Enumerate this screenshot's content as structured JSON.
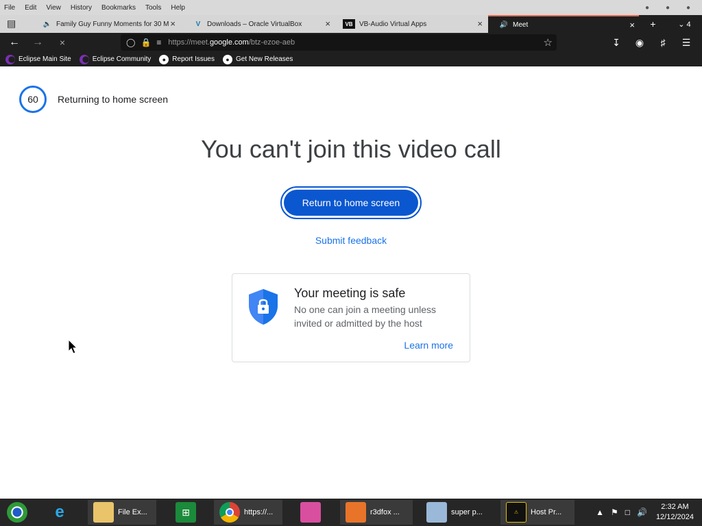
{
  "menubar": {
    "items": [
      "File",
      "Edit",
      "View",
      "History",
      "Bookmarks",
      "Tools",
      "Help"
    ]
  },
  "tabs": [
    {
      "label": "Family Guy Funny Moments for 30 M",
      "icon": "audio-tab-icon"
    },
    {
      "label": "Downloads – Oracle VirtualBox",
      "icon": "virtualbox-icon"
    },
    {
      "label": "VB-Audio Virtual Apps",
      "icon": "vb-audio-icon",
      "icon_text": "VB"
    },
    {
      "label": "Meet",
      "icon": "speaker-icon",
      "active": true
    }
  ],
  "tab_overflow_count": "4",
  "address_bar": {
    "prefix": "https://meet.",
    "domain": "google.com",
    "path": "/btz-ezoe-aeb"
  },
  "bookmarks": [
    {
      "label": "Eclipse Main Site",
      "icon": "eclipse-icon"
    },
    {
      "label": "Eclipse Community",
      "icon": "eclipse-icon"
    },
    {
      "label": "Report Issues",
      "icon": "github-icon"
    },
    {
      "label": "Get New Releases",
      "icon": "github-icon"
    }
  ],
  "meet": {
    "countdown": "60",
    "countdown_label": "Returning to home screen",
    "headline": "You can't join this video call",
    "return_button": "Return to home screen",
    "feedback_link": "Submit feedback",
    "safe_title": "Your meeting is safe",
    "safe_desc": "No one can join a meeting unless invited or admitted by the host",
    "learn_more": "Learn more"
  },
  "taskbar": {
    "items": [
      {
        "label": "",
        "icon": "chrome-old-icon"
      },
      {
        "label": "",
        "icon": "internet-explorer-icon"
      },
      {
        "label": "File Ex...",
        "icon": "file-explorer-icon"
      },
      {
        "label": "",
        "icon": "store-icon"
      },
      {
        "label": "https://...",
        "icon": "chrome-icon"
      },
      {
        "label": "",
        "icon": "pink-cat-icon"
      },
      {
        "label": "r3dfox ...",
        "icon": "r3dfox-icon"
      },
      {
        "label": "super p...",
        "icon": "paint-icon"
      },
      {
        "label": "Host Pr...",
        "icon": "host-process-icon"
      }
    ],
    "time": "2:32 AM",
    "date": "12/12/2024"
  },
  "colors": {
    "accent": "#0b57d0",
    "link": "#1a73e8",
    "browser_dark": "#1f1f1f",
    "active_tab_line": "#e66a4d"
  }
}
